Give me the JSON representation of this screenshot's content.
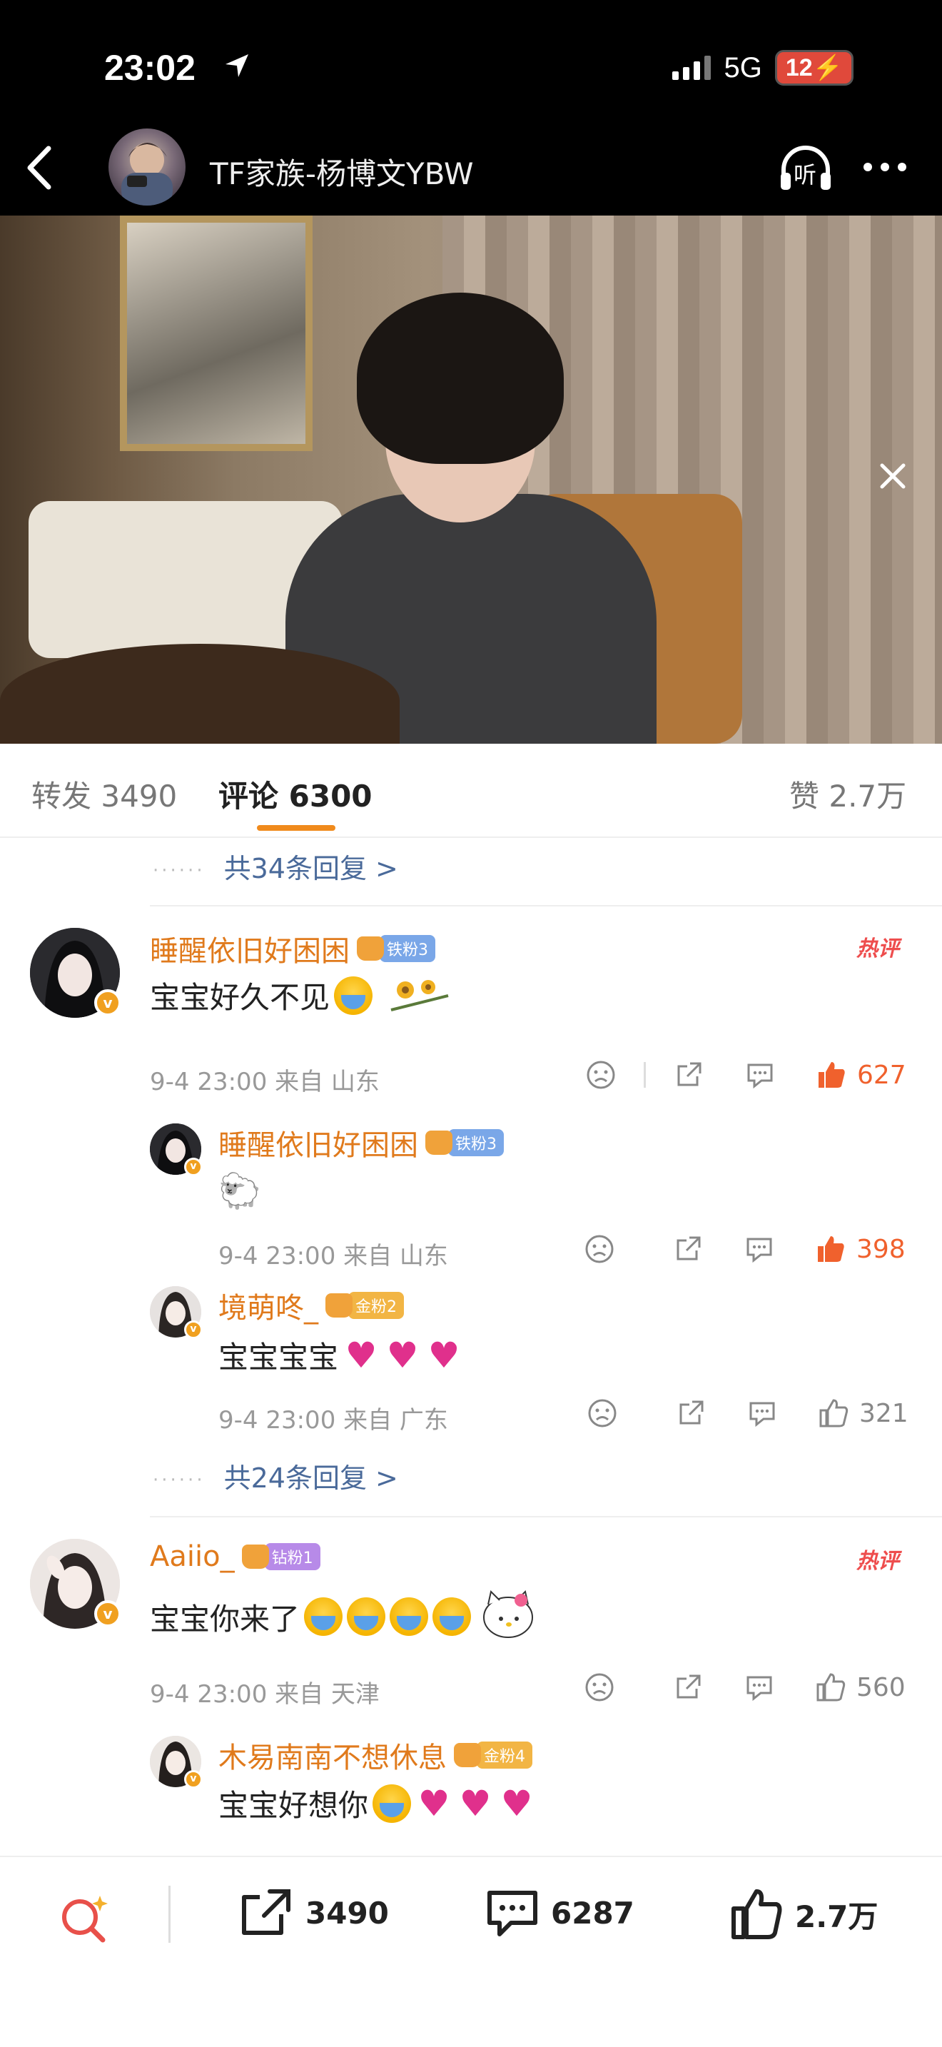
{
  "status": {
    "time": "23:02",
    "network": "5G",
    "battery": "12"
  },
  "header": {
    "title": "TF家族-杨博文YBW",
    "listen_label": "听"
  },
  "tabs": {
    "repost": "转发 3490",
    "comment": "评论 6300",
    "like": "赞 2.7万"
  },
  "top_reply_link": "共34条回复 >",
  "comments": [
    {
      "user": "睡醒依旧好困困",
      "fan_badge": "铁粉3",
      "fan_color": "#7aa7e8",
      "text": "宝宝好久不见",
      "hot": "热评",
      "meta": "9-4 23:00 来自 山东",
      "likes": "627",
      "liked": true,
      "replies": [
        {
          "user": "睡醒依旧好困困",
          "fan_badge": "铁粉3",
          "fan_color": "#7aa7e8",
          "text": "🐑",
          "meta": "9-4 23:00 来自 山东",
          "likes": "398",
          "liked": true
        },
        {
          "user": "境萌咚_",
          "fan_badge": "金粉2",
          "fan_color": "#f2b544",
          "text": "宝宝宝宝",
          "meta": "9-4 23:00 来自 广东",
          "likes": "321",
          "liked": false
        }
      ],
      "more_replies": "共24条回复 >"
    },
    {
      "user": "Aaiio_",
      "fan_badge": "钻粉1",
      "fan_color": "#b78ae8",
      "text": "宝宝你来了",
      "hot": "热评",
      "meta": "9-4 23:00 来自 天津",
      "likes": "560",
      "liked": false,
      "replies": [
        {
          "user": "木易南南不想休息",
          "fan_badge": "金粉4",
          "fan_color": "#f2b544",
          "text": "宝宝好想你",
          "meta": "",
          "likes": "",
          "liked": false
        }
      ]
    }
  ],
  "bottom_bar": {
    "repost_count": "3490",
    "comment_count": "6287",
    "like_count": "2.7万"
  },
  "colors": {
    "accent": "#f08a1c",
    "username": "#e07a1c",
    "liked": "#f0612d",
    "link": "#4a6a9a"
  }
}
